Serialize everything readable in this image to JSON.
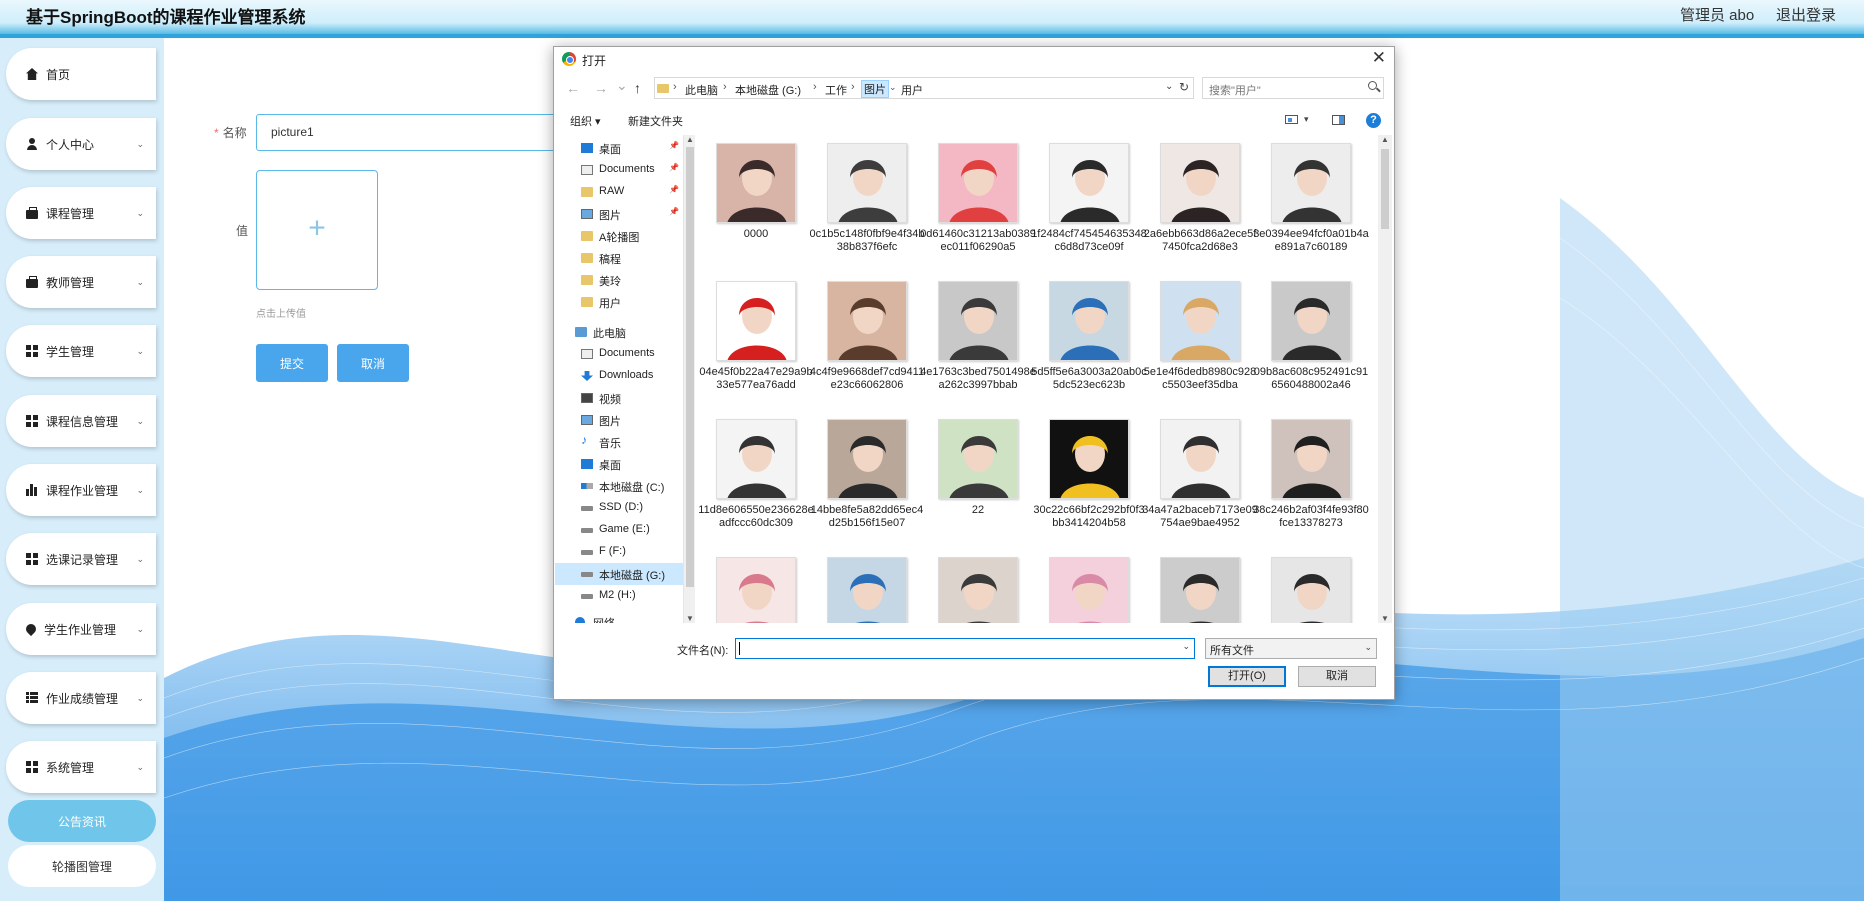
{
  "header": {
    "app_title": "基于SpringBoot的课程作业管理系统",
    "user_label": "管理员 abo",
    "logout_label": "退出登录",
    "accent_color": "#2fa4dc"
  },
  "sidebar": {
    "items": [
      {
        "label": "首页",
        "icon": "home-icon"
      },
      {
        "label": "个人中心",
        "icon": "user-icon"
      },
      {
        "label": "课程管理",
        "icon": "briefcase-icon"
      },
      {
        "label": "教师管理",
        "icon": "briefcase-icon"
      },
      {
        "label": "学生管理",
        "icon": "grid-icon"
      },
      {
        "label": "课程信息管理",
        "icon": "grid-icon"
      },
      {
        "label": "课程作业管理",
        "icon": "bar-chart-icon"
      },
      {
        "label": "选课记录管理",
        "icon": "grid-icon"
      },
      {
        "label": "学生作业管理",
        "icon": "drop-icon"
      },
      {
        "label": "作业成绩管理",
        "icon": "menu-icon"
      },
      {
        "label": "系统管理",
        "icon": "grid-icon"
      }
    ],
    "sub_items": [
      {
        "label": "公告资讯",
        "active": true
      },
      {
        "label": "轮播图管理",
        "active": false
      }
    ]
  },
  "form": {
    "name_label": "名称",
    "name_required": "*",
    "name_value": "picture1",
    "value_label": "值",
    "upload_plus": "+",
    "upload_tip": "点击上传值",
    "submit_label": "提交",
    "cancel_label": "取消"
  },
  "dialog": {
    "title": "打开",
    "close_glyph": "✕",
    "nav": {
      "back": "←",
      "forward": "→",
      "recent": "⌄",
      "up": "↑"
    },
    "breadcrumbs": [
      "此电脑",
      "本地磁盘 (G:)",
      "工作",
      "图片",
      "用户"
    ],
    "search_placeholder": "搜索\"用户\"",
    "toolbar": {
      "organize": "组织 ▾",
      "new_folder": "新建文件夹",
      "help": "?"
    },
    "tree": [
      {
        "label": "桌面",
        "icon": "desktop-icon",
        "pinned": true
      },
      {
        "label": "Documents",
        "icon": "document-icon",
        "pinned": true
      },
      {
        "label": "RAW",
        "icon": "folder-icon",
        "pinned": true
      },
      {
        "label": "图片",
        "icon": "picture-icon",
        "pinned": true
      },
      {
        "label": "A轮播图",
        "icon": "folder-icon",
        "pinned": false
      },
      {
        "label": "稿程",
        "icon": "folder-icon",
        "pinned": false
      },
      {
        "label": "美玲",
        "icon": "folder-icon",
        "pinned": false
      },
      {
        "label": "用户",
        "icon": "folder-icon",
        "pinned": false
      },
      {
        "label": "此电脑",
        "icon": "computer-icon",
        "pinned": false
      },
      {
        "label": "Documents",
        "icon": "document-icon",
        "pinned": false
      },
      {
        "label": "Downloads",
        "icon": "download-icon",
        "pinned": false
      },
      {
        "label": "视频",
        "icon": "video-icon",
        "pinned": false
      },
      {
        "label": "图片",
        "icon": "picture-icon",
        "pinned": false
      },
      {
        "label": "音乐",
        "icon": "music-icon",
        "pinned": false
      },
      {
        "label": "桌面",
        "icon": "desktop-icon",
        "pinned": false
      },
      {
        "label": "本地磁盘 (C:)",
        "icon": "windows-drive-icon",
        "pinned": false
      },
      {
        "label": "SSD (D:)",
        "icon": "drive-icon",
        "pinned": false
      },
      {
        "label": "Game (E:)",
        "icon": "drive-icon",
        "pinned": false
      },
      {
        "label": "F (F:)",
        "icon": "drive-icon",
        "pinned": false
      },
      {
        "label": "本地磁盘 (G:)",
        "icon": "drive-icon",
        "pinned": false,
        "selected": true
      },
      {
        "label": "M2 (H:)",
        "icon": "drive-icon",
        "pinned": false
      },
      {
        "label": "网络",
        "icon": "network-icon",
        "pinned": false
      }
    ],
    "files": [
      {
        "name": "0000",
        "colors": [
          "#d8b4a8",
          "#3a2a2a"
        ]
      },
      {
        "name": "0c1b5c148f0fbf9e4f34b38b837f6efc",
        "colors": [
          "#eeeeee",
          "#3d3d3d"
        ]
      },
      {
        "name": "0d61460c31213ab0389ec011f06290a5",
        "colors": [
          "#f4b8c4",
          "#e14040"
        ]
      },
      {
        "name": "1f2484cf745454635348c6d8d73ce09f",
        "colors": [
          "#f4f4f4",
          "#2a2a2a"
        ]
      },
      {
        "name": "2a6ebb663d86a2ece5f7450fca2d68e3",
        "colors": [
          "#efe7e4",
          "#2c2424"
        ]
      },
      {
        "name": "3e0394ee94fcf0a01b4ae891a7c60189",
        "colors": [
          "#ededed",
          "#333333"
        ]
      },
      {
        "name": "04e45f0b22a47e29a9b33e577ea76add",
        "colors": [
          "#ffffff",
          "#d61f1f"
        ]
      },
      {
        "name": "4c4f9e9668def7cd9411e23c66062806",
        "colors": [
          "#d7b5a0",
          "#5a3c2c"
        ]
      },
      {
        "name": "4e1763c3bed7501498ea262c3997bbab",
        "colors": [
          "#c8c8c8",
          "#3a3a3a"
        ]
      },
      {
        "name": "5d5ff5e6a3003a20ab0c5dc523ec623b",
        "colors": [
          "#c7d8e2",
          "#2a6fb8"
        ]
      },
      {
        "name": "5e1e4f6dedb8980c928c5503eef35dba",
        "colors": [
          "#cfe0f0",
          "#d9a864"
        ]
      },
      {
        "name": "09b8ac608c952491c916560488002a46",
        "colors": [
          "#c9c9c9",
          "#2a2a2a"
        ]
      },
      {
        "name": "11d8e606550e236628eadfccc60dc309",
        "colors": [
          "#f4f4f4",
          "#333333"
        ]
      },
      {
        "name": "14bbe8fe5a82dd65ec4d25b156f15e07",
        "colors": [
          "#b9a89a",
          "#2a2a2a"
        ]
      },
      {
        "name": "22",
        "colors": [
          "#cfe3c4",
          "#3a3a3a"
        ]
      },
      {
        "name": "30c22c66bf2c292bf0f3bb3414204b58",
        "colors": [
          "#111111",
          "#f0c020"
        ]
      },
      {
        "name": "34a47a2baceb7173e09754ae9bae4952",
        "colors": [
          "#f2f2f2",
          "#2f2f2f"
        ]
      },
      {
        "name": "38c246b2af03f4fe93f80fce13378273",
        "colors": [
          "#cfc2bd",
          "#1f1f1f"
        ]
      },
      {
        "name": "",
        "colors": [
          "#f7e6e6",
          "#d97a8c"
        ]
      },
      {
        "name": "",
        "colors": [
          "#c5d6e4",
          "#2a6fb8"
        ]
      },
      {
        "name": "",
        "colors": [
          "#ddd3cd",
          "#3a3a3a"
        ]
      },
      {
        "name": "",
        "colors": [
          "#f3d0dc",
          "#d98aa6"
        ]
      },
      {
        "name": "",
        "colors": [
          "#cccccc",
          "#2a2a2a"
        ]
      },
      {
        "name": "",
        "colors": [
          "#e6e6e6",
          "#2a2a2a"
        ]
      }
    ],
    "filename_label": "文件名(N):",
    "filename_value": "",
    "filetype_value": "所有文件",
    "open_label": "打开(O)",
    "cancel_label": "取消"
  }
}
